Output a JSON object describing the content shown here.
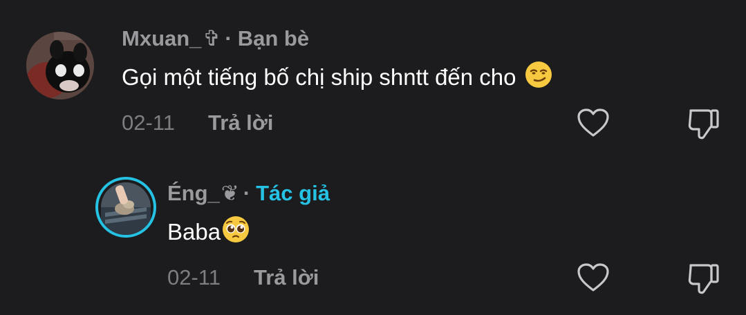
{
  "comments": [
    {
      "username": "Mxuan_",
      "username_glyph": "✞",
      "relation": "Bạn bè",
      "text": "Gọi một tiếng bố chị ship shntt đến cho",
      "emoji": "smirking-face",
      "date": "02-11",
      "reply_label": "Trả lời"
    },
    {
      "username": "Éng_",
      "username_glyph": "❦",
      "relation": "Tác giả",
      "text": "Baba",
      "emoji": "pleading-face",
      "date": "02-11",
      "reply_label": "Trả lời"
    }
  ],
  "separator": "·",
  "colors": {
    "background": "#1c1c1e",
    "author_accent": "#25c2e3",
    "muted_text": "#9a9a9e",
    "date_text": "#7d7d82"
  }
}
